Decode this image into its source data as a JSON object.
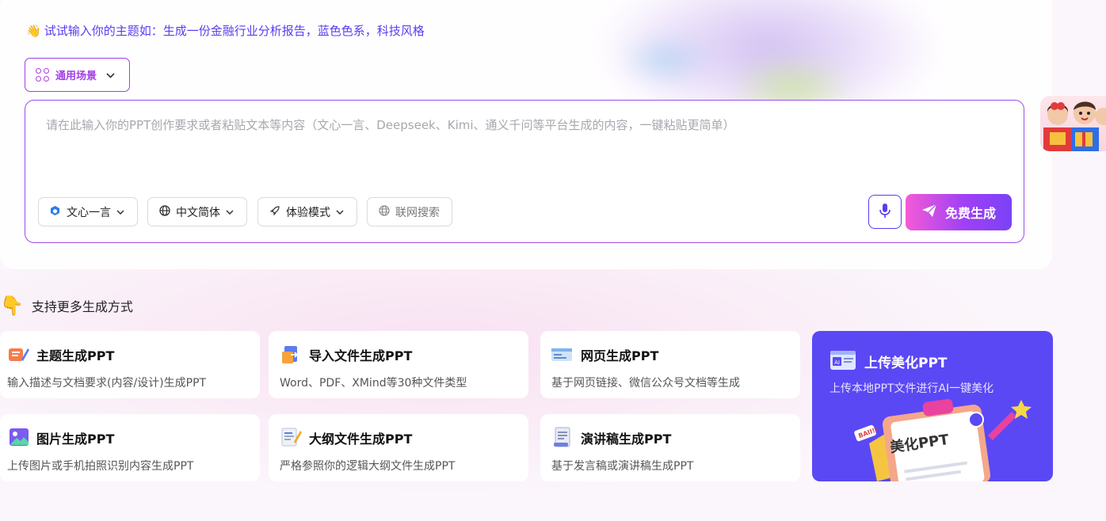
{
  "hint": {
    "emoji": "👋",
    "text": "试试输入你的主题如：生成一份金融行业分析报告，蓝色色系，科技风格"
  },
  "scene": {
    "label": "通用场景"
  },
  "prompt": {
    "placeholder": "请在此输入你的PPT创作要求或者粘贴文本等内容（文心一言、Deepseek、Kimi、通义千问等平台生成的内容，一键粘贴更简单）",
    "value": ""
  },
  "toolbar": {
    "model": "文心一言",
    "language": "中文简体",
    "mode": "体验模式",
    "web_search": "联网搜索",
    "generate": "免费生成"
  },
  "more": {
    "title": "支持更多生成方式",
    "cards": [
      {
        "title": "主题生成PPT",
        "desc": "输入描述与文档要求(内容/设计)生成PPT",
        "icon": "pencil-board-icon"
      },
      {
        "title": "导入文件生成PPT",
        "desc": "Word、PDF、XMind等30种文件类型",
        "icon": "file-import-icon"
      },
      {
        "title": "网页生成PPT",
        "desc": "基于网页链接、微信公众号文档等生成",
        "icon": "webpage-icon"
      },
      {
        "title": "图片生成PPT",
        "desc": "上传图片或手机拍照识别内容生成PPT",
        "icon": "image-icon"
      },
      {
        "title": "大纲文件生成PPT",
        "desc": "严格参照你的逻辑大纲文件生成PPT",
        "icon": "outline-icon"
      },
      {
        "title": "演讲稿生成PPT",
        "desc": "基于发言稿或演讲稿生成PPT",
        "icon": "speech-icon"
      }
    ],
    "featured": {
      "title": "上传美化PPT",
      "desc": "上传本地PPT文件进行AI一键美化",
      "badge": "美化PPT",
      "tag": "BAII!!"
    }
  },
  "colors": {
    "accent": "#5b3cf0",
    "brand_purple": "#a23fe6",
    "featured_bg": "#5a48f5"
  }
}
